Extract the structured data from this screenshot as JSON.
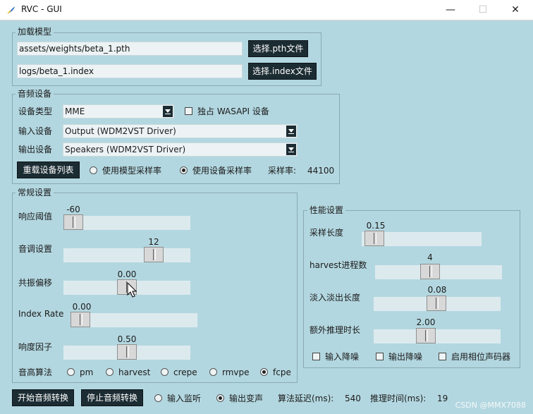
{
  "window": {
    "title": "RVC - GUI"
  },
  "load_model": {
    "legend": "加载模型",
    "pth_path": "assets/weights/beta_1.pth",
    "index_path": "logs/beta_1.index",
    "select_pth": "选择.pth文件",
    "select_index": "选择.index文件"
  },
  "audio": {
    "legend": "音频设备",
    "device_type_label": "设备类型",
    "device_type": "MME",
    "exclusive_label": "独占 WASAPI 设备",
    "exclusive_checked": false,
    "input_label": "输入设备",
    "input_device": "Output (WDM2VST Driver)",
    "output_label": "输出设备",
    "output_device": "Speakers (WDM2VST Driver)",
    "reload_button": "重载设备列表",
    "rate_model": "使用模型采样率",
    "rate_device": "使用设备采样率",
    "selected_rate": "device",
    "sample_rate_label": "采样率:",
    "sample_rate": "44100"
  },
  "general": {
    "legend": "常规设置",
    "sliders": [
      {
        "label": "响应阈值",
        "value": "-60",
        "fraction": 0.0
      },
      {
        "label": "音调设置",
        "value": "12",
        "fraction": 0.75
      },
      {
        "label": "共振偏移",
        "value": "0.00",
        "fraction": 0.5
      },
      {
        "label": "Index Rate",
        "value": "0.00",
        "fraction": 0.0
      },
      {
        "label": "响度因子",
        "value": "0.50",
        "fraction": 0.5
      }
    ],
    "algorithm_label": "音高算法",
    "algorithms": [
      "pm",
      "harvest",
      "crepe",
      "rmvpe",
      "fcpe"
    ],
    "selected_algorithm": "fcpe"
  },
  "performance": {
    "legend": "性能设置",
    "sliders": [
      {
        "label": "采样长度",
        "value": "0.15",
        "fraction": 0.05
      },
      {
        "label": "harvest进程数",
        "value": "4",
        "fraction": 0.37
      },
      {
        "label": "淡入淡出长度",
        "value": "0.08",
        "fraction": 0.41
      },
      {
        "label": "额外推理时长",
        "value": "2.00",
        "fraction": 0.35
      }
    ],
    "checks": [
      {
        "label": "输入降噪",
        "checked": false
      },
      {
        "label": "输出降噪",
        "checked": false
      },
      {
        "label": "启用相位声码器",
        "checked": false
      }
    ]
  },
  "bottom": {
    "start_button": "开始音频转换",
    "stop_button": "停止音频转换",
    "monitor_input": "输入监听",
    "output_voice": "输出变声",
    "selected_monitor": "output",
    "latency_label": "算法延迟(ms):",
    "latency_value": "540",
    "infer_label": "推理时间(ms):",
    "infer_value": "19"
  },
  "watermark": "CSDN @MMX7088"
}
